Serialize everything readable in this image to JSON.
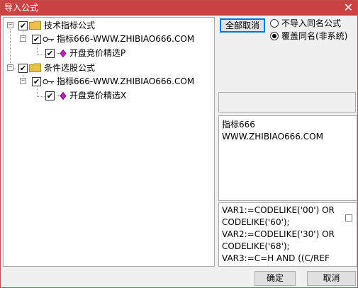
{
  "window": {
    "title": "导入公式",
    "close_glyph": "✕"
  },
  "tree": {
    "nodes": [
      {
        "label": "技术指标公式",
        "checked": true,
        "expander": "−"
      },
      {
        "label": "指标666-WWW.ZHIBIAO666.COM",
        "checked": true,
        "expander": "−"
      },
      {
        "label": "开盘竞价精选P",
        "checked": true
      },
      {
        "label": "条件选股公式",
        "checked": true,
        "expander": "−"
      },
      {
        "label": "指标666-WWW.ZHIBIAO666.COM",
        "checked": true,
        "expander": "−"
      },
      {
        "label": "开盘竞价精选X",
        "checked": true
      }
    ],
    "check_glyph": "✔"
  },
  "options": {
    "uncheck_all_label": "全部取消",
    "radio_skip_label": "不导入同名公式",
    "radio_overwrite_label": "覆盖同名(非系统)",
    "selected": "overwrite"
  },
  "info": {
    "text": "指标666\nWWW.ZHIBIAO666.COM"
  },
  "code": {
    "text": "VAR1:=CODELIKE('00') OR\nCODELIKE('60');\nVAR2:=CODELIKE('30') OR\nCODELIKE('68');\nVAR3:=C=H AND ((C/REF"
  },
  "footer": {
    "ok_label": "确定",
    "cancel_label": "取消"
  },
  "colors": {
    "titlebar": "#c94343",
    "folder": "#e8c34a",
    "diamond": "#c020c0"
  }
}
